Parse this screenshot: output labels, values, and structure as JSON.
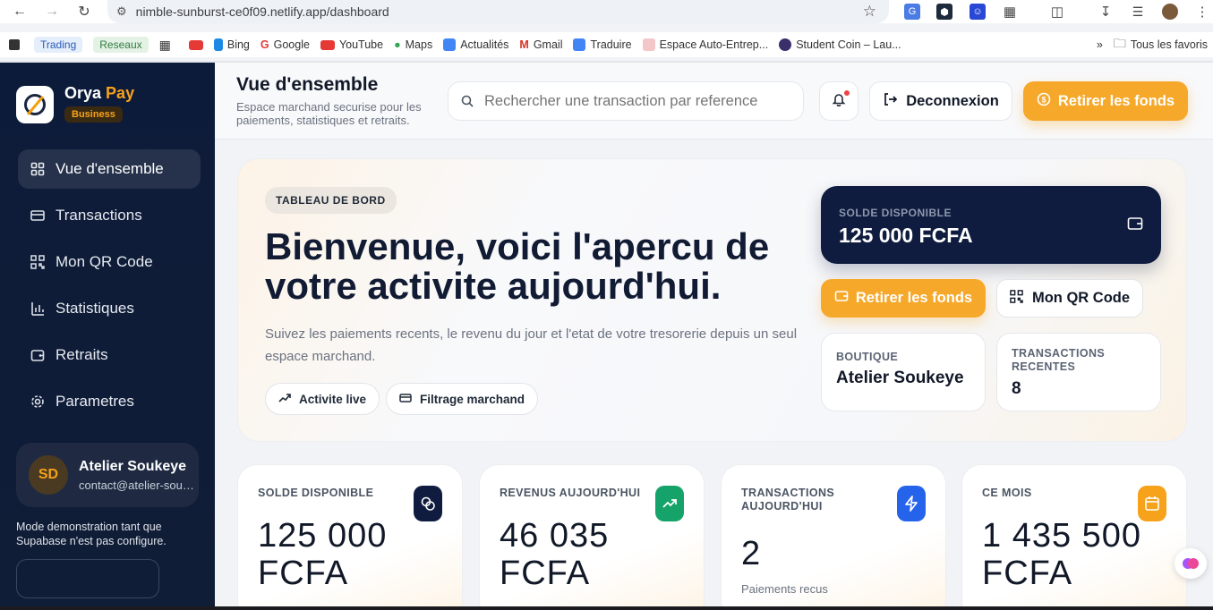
{
  "browser": {
    "url": "nimble-sunburst-ce0f09.netlify.app/dashboard",
    "bookmarks": [
      {
        "label": "Trading"
      },
      {
        "label": "Reseaux"
      },
      {
        "label": "Bing"
      },
      {
        "label": "Google"
      },
      {
        "label": "YouTube"
      },
      {
        "label": "Maps"
      },
      {
        "label": "Actualités"
      },
      {
        "label": "Gmail"
      },
      {
        "label": "Traduire"
      },
      {
        "label": "Espace Auto-Entrep..."
      },
      {
        "label": "Student Coin – Lau..."
      }
    ],
    "all_bookmarks": "Tous les favoris"
  },
  "sidebar": {
    "brand_main": "Orya",
    "brand_accent": "Pay",
    "badge": "Business",
    "items": [
      {
        "label": "Vue d'ensemble",
        "icon": "grid-icon"
      },
      {
        "label": "Transactions",
        "icon": "card-icon"
      },
      {
        "label": "Mon QR Code",
        "icon": "qr-icon"
      },
      {
        "label": "Statistiques",
        "icon": "chart-icon"
      },
      {
        "label": "Retraits",
        "icon": "wallet-icon"
      },
      {
        "label": "Parametres",
        "icon": "gear-icon"
      }
    ],
    "user": {
      "initials": "SD",
      "name": "Atelier Soukeye",
      "email": "contact@atelier-soukeye"
    },
    "demo_note": "Mode demonstration tant que Supabase n'est pas configure."
  },
  "header": {
    "title": "Vue d'ensemble",
    "subtitle": "Espace marchand securise pour les paiements, statistiques et retraits.",
    "search_placeholder": "Rechercher une transaction par reference",
    "logout_label": "Deconnexion",
    "withdraw_label": "Retirer les fonds"
  },
  "hero": {
    "tag": "TABLEAU DE BORD",
    "title": "Bienvenue, voici l'apercu de votre activite aujourd'hui.",
    "description": "Suivez les paiements recents, le revenu du jour et l'etat de votre tresorerie depuis un seul espace marchand.",
    "pill_live": "Activite live",
    "pill_filter": "Filtrage marchand",
    "balance_label": "SOLDE DISPONIBLE",
    "balance_value": "125 000 FCFA",
    "withdraw_label": "Retirer les fonds",
    "qr_label": "Mon QR Code",
    "shop_label": "BOUTIQUE",
    "shop_value": "Atelier Soukeye",
    "recent_label": "TRANSACTIONS RECENTES",
    "recent_value": "8"
  },
  "stats": [
    {
      "label": "SOLDE DISPONIBLE",
      "value": "125 000 FCFA",
      "sub": "",
      "icon": "coins-icon",
      "color": "#0f1c3f"
    },
    {
      "label": "REVENUS AUJOURD'HUI",
      "value": "46 035 FCFA",
      "sub": "",
      "icon": "trending-up-icon",
      "color": "#16a36a"
    },
    {
      "label": "TRANSACTIONS AUJOURD'HUI",
      "value": "2",
      "sub": "Paiements recus",
      "icon": "lightning-icon",
      "color": "#2563eb"
    },
    {
      "label": "CE MOIS",
      "value": "1 435 500 FCFA",
      "sub": "",
      "icon": "calendar-icon",
      "color": "#f6a21a"
    }
  ]
}
